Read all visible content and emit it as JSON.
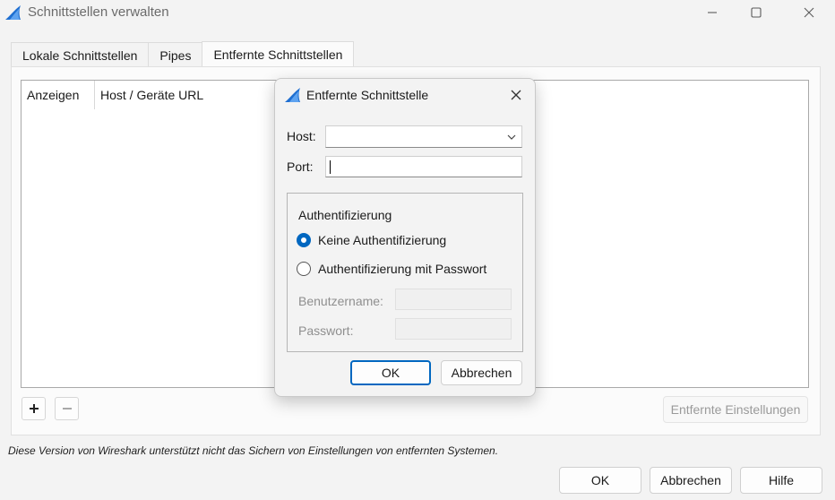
{
  "window": {
    "title": "Schnittstellen verwalten",
    "icon": "wireshark-fin-icon",
    "accent_color": "#0067c0"
  },
  "tabs": [
    {
      "label": "Lokale Schnittstellen",
      "active": false
    },
    {
      "label": "Pipes",
      "active": false
    },
    {
      "label": "Entfernte Schnittstellen",
      "active": true
    }
  ],
  "table": {
    "columns": [
      "Anzeigen",
      "Host / Geräte URL"
    ],
    "rows": []
  },
  "toolbar": {
    "add_icon": "plus-icon",
    "remove_icon": "minus-icon",
    "remote_settings_label": "Entfernte Einstellungen"
  },
  "notice": "Diese Version von Wireshark unterstützt nicht das Sichern von Einstellungen von entfernten Systemen.",
  "buttons": {
    "ok": "OK",
    "cancel": "Abbrechen",
    "help": "Hilfe"
  },
  "dialog": {
    "title": "Entfernte Schnittstelle",
    "host_label": "Host:",
    "host_value": "",
    "port_label": "Port:",
    "port_value": "",
    "auth_group_title": "Authentifizierung",
    "auth_options": [
      {
        "label": "Keine Authentifizierung",
        "checked": true
      },
      {
        "label": "Authentifizierung mit Passwort",
        "checked": false
      }
    ],
    "username_label": "Benutzername:",
    "username_value": "",
    "password_label": "Passwort:",
    "password_value": "",
    "ok_label": "OK",
    "cancel_label": "Abbrechen"
  }
}
